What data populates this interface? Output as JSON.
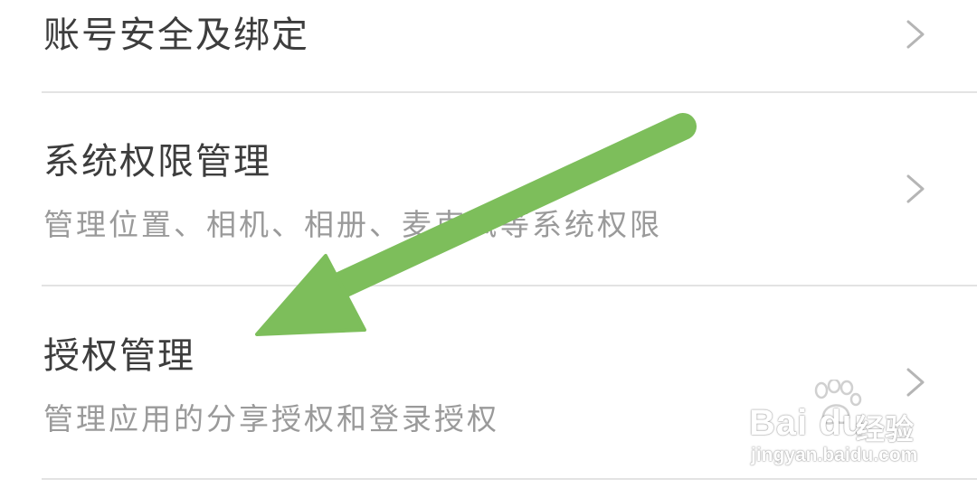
{
  "settings_list": [
    {
      "title": "账号安全及绑定",
      "subtitle": ""
    },
    {
      "title": "系统权限管理",
      "subtitle": "管理位置、相机、相册、麦克风等系统权限"
    },
    {
      "title": "授权管理",
      "subtitle": "管理应用的分享授权和登录授权"
    }
  ],
  "icons": {
    "chevron": "chevron-right-icon",
    "arrow": "green-arrow-annotation"
  },
  "colors": {
    "arrow": "#7dbe5b",
    "title_text": "#3d3d3d",
    "subtitle_text": "#9a9a9a",
    "divider": "#e3e3e3"
  },
  "watermark": {
    "brand": "Bai  du",
    "cn": "经验",
    "url": "jingyan.baidu.com"
  }
}
